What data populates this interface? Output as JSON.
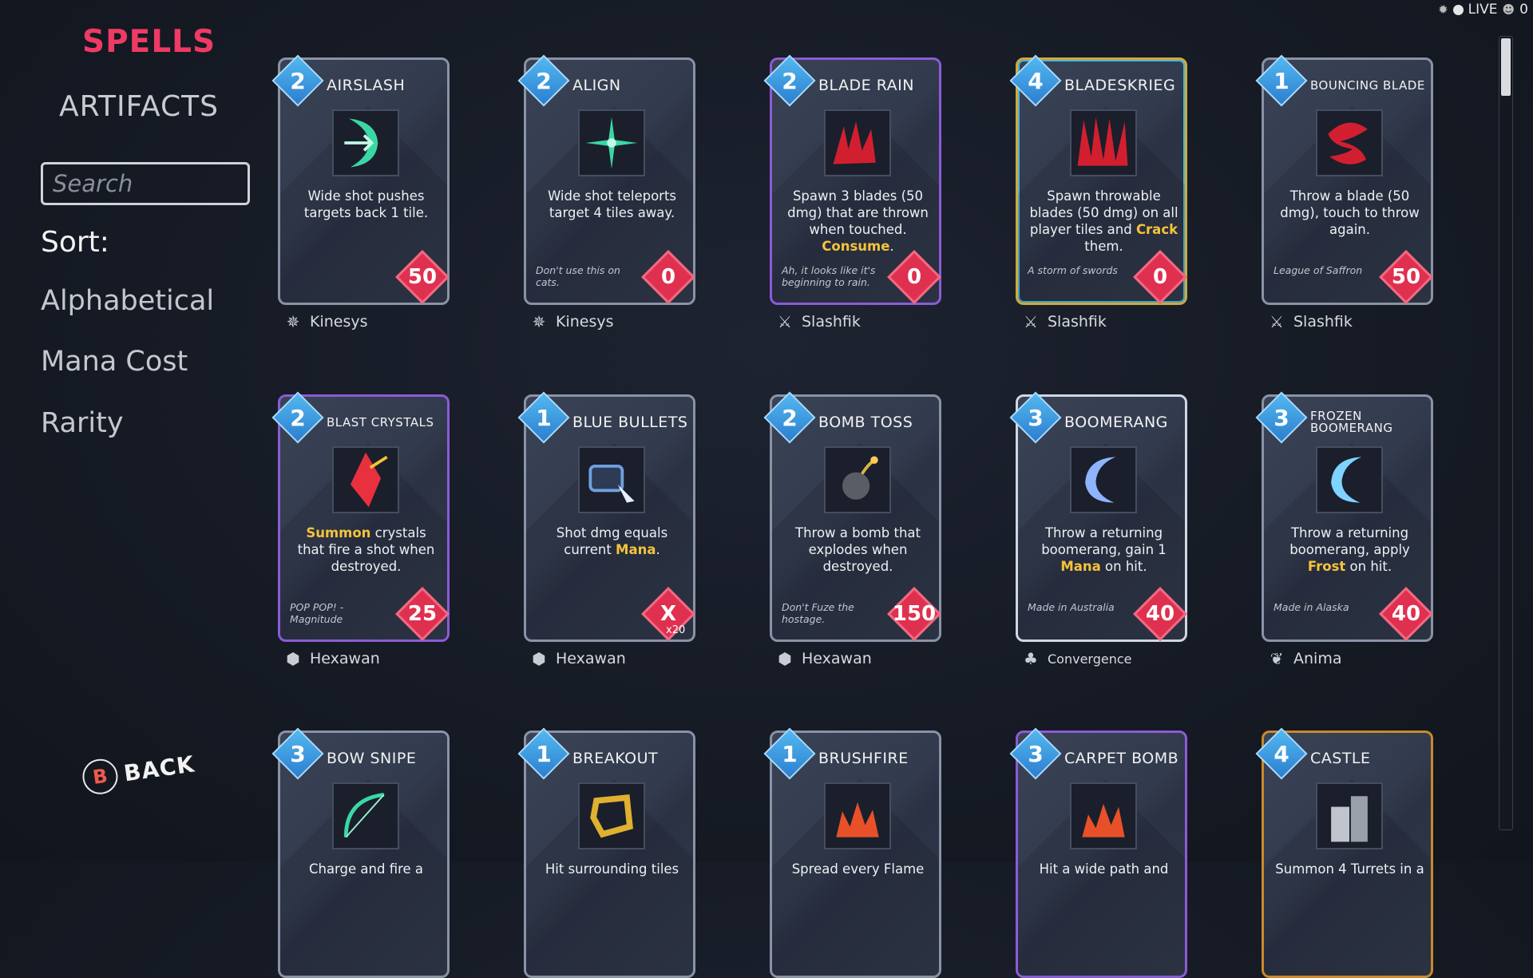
{
  "status": {
    "bug_icon": "bug-icon",
    "live_label": "LIVE",
    "viewer_count": "0"
  },
  "nav": {
    "spells": "SPELLS",
    "artifacts": "ARTIFACTS"
  },
  "search": {
    "placeholder": "Search",
    "value": ""
  },
  "sort": {
    "label": "Sort:",
    "options": [
      "Alphabetical",
      "Mana Cost",
      "Rarity"
    ]
  },
  "back": {
    "button_glyph": "B",
    "label": "BACK"
  },
  "colors": {
    "accent": "#ee3b63",
    "mana_gem": "#3a96e0",
    "cost_gem": "#e0304f",
    "highlight": "#f5c33b"
  },
  "cards": [
    {
      "title": "AIRSLASH",
      "mana": "2",
      "desc": "Wide shot pushes targets back 1 tile.",
      "flavor": "",
      "cost": "50",
      "cost_sub": "",
      "element": "Kinesys",
      "element_icon": "kinesys-icon",
      "rarity": "common",
      "art_color": "#3ad7a5"
    },
    {
      "title": "ALIGN",
      "mana": "2",
      "desc": "Wide shot teleports target 4 tiles away.",
      "flavor": "Don't use this on cats.",
      "cost": "0",
      "cost_sub": "",
      "element": "Kinesys",
      "element_icon": "kinesys-icon",
      "rarity": "common",
      "art_color": "#3ad7a5"
    },
    {
      "title": "BLADE RAIN",
      "mana": "2",
      "desc_parts": [
        "Spawn 3 blades (50 dmg) that are thrown when touched. ",
        "Consume",
        "."
      ],
      "flavor": "Ah, it looks like it's beginning to rain.",
      "cost": "0",
      "cost_sub": "",
      "element": "Slashfik",
      "element_icon": "sword-icon",
      "rarity": "purple",
      "art_color": "#d21f2f"
    },
    {
      "title": "BLADESKRIEG",
      "mana": "4",
      "desc_parts": [
        "Spawn throwable blades (50 dmg) on all player tiles and ",
        "Crack",
        " them."
      ],
      "flavor": "A storm of swords",
      "cost": "0",
      "cost_sub": "",
      "element": "Slashfik",
      "element_icon": "sword-icon",
      "rarity": "rainbow",
      "art_color": "#d21f2f"
    },
    {
      "title": "BOUNCING BLADE",
      "mana": "1",
      "desc": "Throw a blade (50 dmg), touch to throw again.",
      "flavor": "League of Saffron",
      "cost": "50",
      "cost_sub": "",
      "element": "Slashfik",
      "element_icon": "sword-icon",
      "rarity": "common",
      "art_color": "#d21f2f"
    },
    {
      "title": "BLAST CRYSTALS",
      "mana": "2",
      "desc_parts": [
        "",
        "Summon",
        " crystals that fire a shot when destroyed."
      ],
      "flavor": "POP POP! - Magnitude",
      "cost": "25",
      "cost_sub": "",
      "element": "Hexawan",
      "element_icon": "hexawan-icon",
      "rarity": "purple",
      "art_color": "#e8303e"
    },
    {
      "title": "BLUE BULLETS",
      "mana": "1",
      "desc_parts": [
        "Shot dmg equals current ",
        "Mana",
        "."
      ],
      "flavor": "",
      "cost": "X",
      "cost_sub": "x20",
      "element": "Hexawan",
      "element_icon": "hexawan-icon",
      "rarity": "common",
      "art_color": "#6fa0e0"
    },
    {
      "title": "BOMB TOSS",
      "mana": "2",
      "desc": "Throw a bomb that explodes when destroyed.",
      "flavor": "Don't Fuze the hostage.",
      "cost": "150",
      "cost_sub": "",
      "element": "Hexawan",
      "element_icon": "hexawan-icon",
      "rarity": "common",
      "art_color": "#d9b44a"
    },
    {
      "title": "BOOMERANG",
      "mana": "3",
      "desc_parts": [
        "Throw a returning boomerang, gain 1 ",
        "Mana",
        " on hit."
      ],
      "flavor": "Made in Australia",
      "cost": "40",
      "cost_sub": "",
      "element": "Convergence",
      "element_icon": "convergence-icon",
      "rarity": "white",
      "art_color": "#8fb4ff"
    },
    {
      "title": "FROZEN BOOMERANG",
      "mana": "3",
      "desc_parts": [
        "Throw a returning boomerang, apply ",
        "Frost",
        " on hit."
      ],
      "flavor": "Made in Alaska",
      "cost": "40",
      "cost_sub": "",
      "element": "Anima",
      "element_icon": "anima-icon",
      "rarity": "common",
      "art_color": "#7ed4ff"
    },
    {
      "title": "BOW SNIPE",
      "mana": "3",
      "desc": "Charge and fire a",
      "flavor": "",
      "cost": "",
      "cost_sub": "",
      "element": "",
      "element_icon": "",
      "rarity": "common",
      "art_color": "#3ad7a5"
    },
    {
      "title": "BREAKOUT",
      "mana": "1",
      "desc": "Hit surrounding tiles",
      "flavor": "",
      "cost": "",
      "cost_sub": "",
      "element": "",
      "element_icon": "",
      "rarity": "common",
      "art_color": "#e0b030"
    },
    {
      "title": "BRUSHFIRE",
      "mana": "1",
      "desc": "Spread every Flame",
      "flavor": "",
      "cost": "",
      "cost_sub": "",
      "element": "",
      "element_icon": "",
      "rarity": "common",
      "art_color": "#e8502a"
    },
    {
      "title": "CARPET BOMB",
      "mana": "3",
      "desc": "Hit a wide path and",
      "flavor": "",
      "cost": "",
      "cost_sub": "",
      "element": "",
      "element_icon": "",
      "rarity": "purple",
      "art_color": "#e8502a"
    },
    {
      "title": "CASTLE",
      "mana": "4",
      "desc": "Summon 4 Turrets in a",
      "flavor": "",
      "cost": "",
      "cost_sub": "",
      "element": "",
      "element_icon": "",
      "rarity": "gold",
      "art_color": "#c0c4cc"
    }
  ]
}
